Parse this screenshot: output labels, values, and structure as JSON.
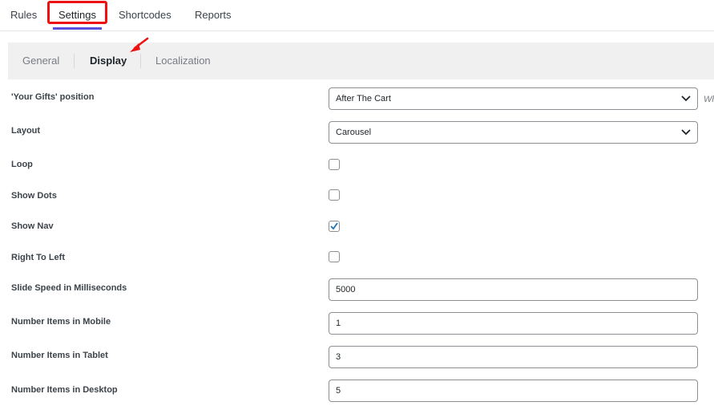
{
  "top_tabs": [
    "Rules",
    "Settings",
    "Shortcodes",
    "Reports"
  ],
  "sub_tabs": [
    "General",
    "Display",
    "Localization"
  ],
  "fields": {
    "gifts_position": {
      "label": "'Your Gifts' position",
      "value": "After The Cart",
      "hint": "Wh"
    },
    "layout": {
      "label": "Layout",
      "value": "Carousel"
    },
    "loop": {
      "label": "Loop",
      "checked": false
    },
    "show_dots": {
      "label": "Show Dots",
      "checked": false
    },
    "show_nav": {
      "label": "Show Nav",
      "checked": true
    },
    "rtl": {
      "label": "Right To Left",
      "checked": false
    },
    "slide_speed": {
      "label": "Slide Speed in Milliseconds",
      "value": "5000"
    },
    "items_mobile": {
      "label": "Number Items in Mobile",
      "value": "1"
    },
    "items_tablet": {
      "label": "Number Items in Tablet",
      "value": "3"
    },
    "items_desktop": {
      "label": "Number Items in Desktop",
      "value": "5"
    }
  },
  "colors": {
    "highlight_box": "#ee1111",
    "active_underline": "#5b4fe0",
    "checkmark": "#2271b1"
  }
}
